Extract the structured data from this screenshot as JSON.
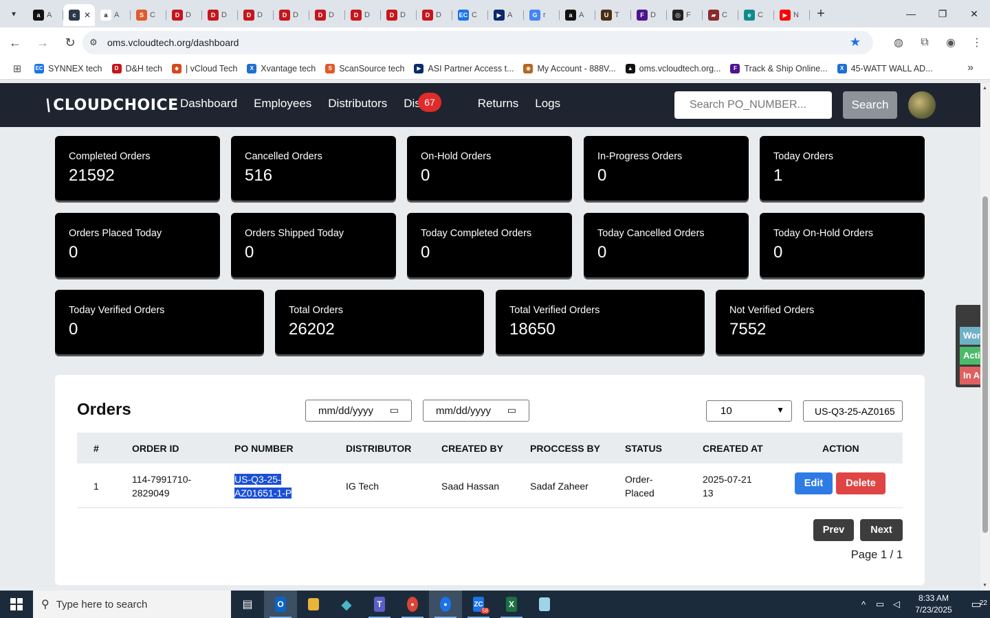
{
  "browser": {
    "tabs": [
      {
        "icon": "amazon-icon",
        "color": "#111111",
        "glyph": "a",
        "title": "A"
      },
      {
        "icon": "cloudchoice-icon",
        "color": "#2b3a4a",
        "glyph": "c",
        "title": "",
        "active": true
      },
      {
        "icon": "amazon-icon",
        "color": "#ffffff",
        "glyph": "a",
        "title": "A"
      },
      {
        "icon": "scansource-icon",
        "color": "#e05a2b",
        "glyph": "S",
        "title": "C"
      },
      {
        "icon": "dh-icon",
        "color": "#c4161c",
        "glyph": "D",
        "title": "D"
      },
      {
        "icon": "dh-icon",
        "color": "#c4161c",
        "glyph": "D",
        "title": "D"
      },
      {
        "icon": "dh-icon",
        "color": "#c4161c",
        "glyph": "D",
        "title": "D"
      },
      {
        "icon": "dh-icon",
        "color": "#c4161c",
        "glyph": "D",
        "title": "D"
      },
      {
        "icon": "dh-icon",
        "color": "#c4161c",
        "glyph": "D",
        "title": "D"
      },
      {
        "icon": "dh-icon",
        "color": "#c4161c",
        "glyph": "D",
        "title": "D"
      },
      {
        "icon": "dh-icon",
        "color": "#c4161c",
        "glyph": "D",
        "title": "D"
      },
      {
        "icon": "dh-icon",
        "color": "#c4161c",
        "glyph": "D",
        "title": "D"
      },
      {
        "icon": "ec-icon",
        "color": "#1a73e8",
        "glyph": "EC",
        "title": "C"
      },
      {
        "icon": "asi-icon",
        "color": "#0b2a6b",
        "glyph": "▶",
        "title": "A"
      },
      {
        "icon": "google-icon",
        "color": "#4285f4",
        "glyph": "G",
        "title": "r"
      },
      {
        "icon": "amazon-icon",
        "color": "#111111",
        "glyph": "a",
        "title": "A"
      },
      {
        "icon": "ups-icon",
        "color": "#4b2e12",
        "glyph": "U",
        "title": "T"
      },
      {
        "icon": "fedex-icon",
        "color": "#4d148c",
        "glyph": "F",
        "title": "D"
      },
      {
        "icon": "openai-icon",
        "color": "#222222",
        "glyph": "◎",
        "title": "F"
      },
      {
        "icon": "truck-icon",
        "color": "#8a2b2b",
        "glyph": "▰",
        "title": "C"
      },
      {
        "icon": "edge-icon",
        "color": "#0f8b8d",
        "glyph": "e",
        "title": "C"
      },
      {
        "icon": "youtube-icon",
        "color": "#ff0000",
        "glyph": "▶",
        "title": "N"
      }
    ],
    "url": "oms.vcloudtech.org/dashboard",
    "bookmarks": [
      {
        "icon": "ec-icon",
        "color": "#1a73e8",
        "glyph": "EC",
        "label": "SYNNEX tech"
      },
      {
        "icon": "dh-icon",
        "color": "#c4161c",
        "glyph": "D",
        "label": "D&H tech"
      },
      {
        "icon": "vcloud-icon",
        "color": "#d44a1f",
        "glyph": "◆",
        "label": "| vCloud Tech"
      },
      {
        "icon": "xvantage-icon",
        "color": "#1f6fd1",
        "glyph": "X",
        "label": "Xvantage tech"
      },
      {
        "icon": "scansource-icon",
        "color": "#e05a2b",
        "glyph": "S",
        "label": "ScanSource tech"
      },
      {
        "icon": "asi-icon",
        "color": "#0b2a6b",
        "glyph": "▶",
        "label": "ASI Partner Access t..."
      },
      {
        "icon": "account-icon",
        "color": "#b5651d",
        "glyph": "◉",
        "label": "My Account - 888V..."
      },
      {
        "icon": "oms-icon",
        "color": "#111111",
        "glyph": "▲",
        "label": "oms.vcloudtech.org..."
      },
      {
        "icon": "fedex-icon",
        "color": "#4d148c",
        "glyph": "F",
        "label": "Track & Ship Online..."
      },
      {
        "icon": "xvantage-icon",
        "color": "#1f6fd1",
        "glyph": "X",
        "label": "45-WATT WALL AD..."
      }
    ]
  },
  "app": {
    "brand": "CLOUDCHOICE",
    "nav": [
      "Dashboard",
      "Employees",
      "Distributors",
      "Dispu",
      "Returns",
      "Logs"
    ],
    "disputes_badge": "67",
    "search_placeholder": "Search PO_NUMBER...",
    "search_button": "Search",
    "stats_row1": [
      {
        "label": "Completed Orders",
        "value": "21592"
      },
      {
        "label": "Cancelled Orders",
        "value": "516"
      },
      {
        "label": "On-Hold Orders",
        "value": "0"
      },
      {
        "label": "In-Progress Orders",
        "value": "0"
      },
      {
        "label": "Today Orders",
        "value": "1"
      }
    ],
    "stats_row2": [
      {
        "label": "Orders Placed Today",
        "value": "0"
      },
      {
        "label": "Orders Shipped Today",
        "value": "0"
      },
      {
        "label": "Today Completed Orders",
        "value": "0"
      },
      {
        "label": "Today Cancelled Orders",
        "value": "0"
      },
      {
        "label": "Today On-Hold Orders",
        "value": "0"
      }
    ],
    "stats_row3": [
      {
        "label": "Today Verified Orders",
        "value": "0"
      },
      {
        "label": "Total Orders",
        "value": "26202"
      },
      {
        "label": "Total Verified Orders",
        "value": "18650"
      },
      {
        "label": "Not Verified Orders",
        "value": "7552"
      }
    ],
    "orders": {
      "title": "Orders",
      "date_from": "mm/dd/yyyy",
      "date_to": "mm/dd/yyyy",
      "page_size": "10",
      "filter_value": "US-Q3-25-AZ0165",
      "columns": [
        "#",
        "ORDER ID",
        "PO NUMBER",
        "DISTRIBUTOR",
        "CREATED BY",
        "PROCCESS BY",
        "STATUS",
        "CREATED AT",
        "ACTION"
      ],
      "rows": [
        {
          "index": "1",
          "order_id_1": "114-7991710-",
          "order_id_2": "2829049",
          "po_1": "US-Q3-25-",
          "po_2": "AZ01651-1-P",
          "distributor": "IG Tech",
          "created_by": "Saad Hassan",
          "process_by": "Sadaf Zaheer",
          "status_1": "Order-",
          "status_2": "Placed",
          "created_at_1": "2025-07-21",
          "created_at_2": "13",
          "edit": "Edit",
          "delete": "Delete"
        }
      ],
      "prev": "Prev",
      "next": "Next",
      "page_info": "Page 1 / 1"
    },
    "side_widget": [
      "Working",
      "Active",
      "In Active"
    ]
  },
  "taskbar": {
    "search_placeholder": "Type here to search",
    "time": "8:33 AM",
    "date": "7/23/2025",
    "notifications": "22",
    "zoom_badge": "58"
  },
  "colors": {
    "navbar": "#1e2530",
    "card": "#000000",
    "edit": "#2f7be6",
    "delete": "#e04545",
    "selection": "#1a4fd6",
    "working": "#6fb2c6",
    "active": "#4cba6a",
    "inactive": "#e06060"
  }
}
